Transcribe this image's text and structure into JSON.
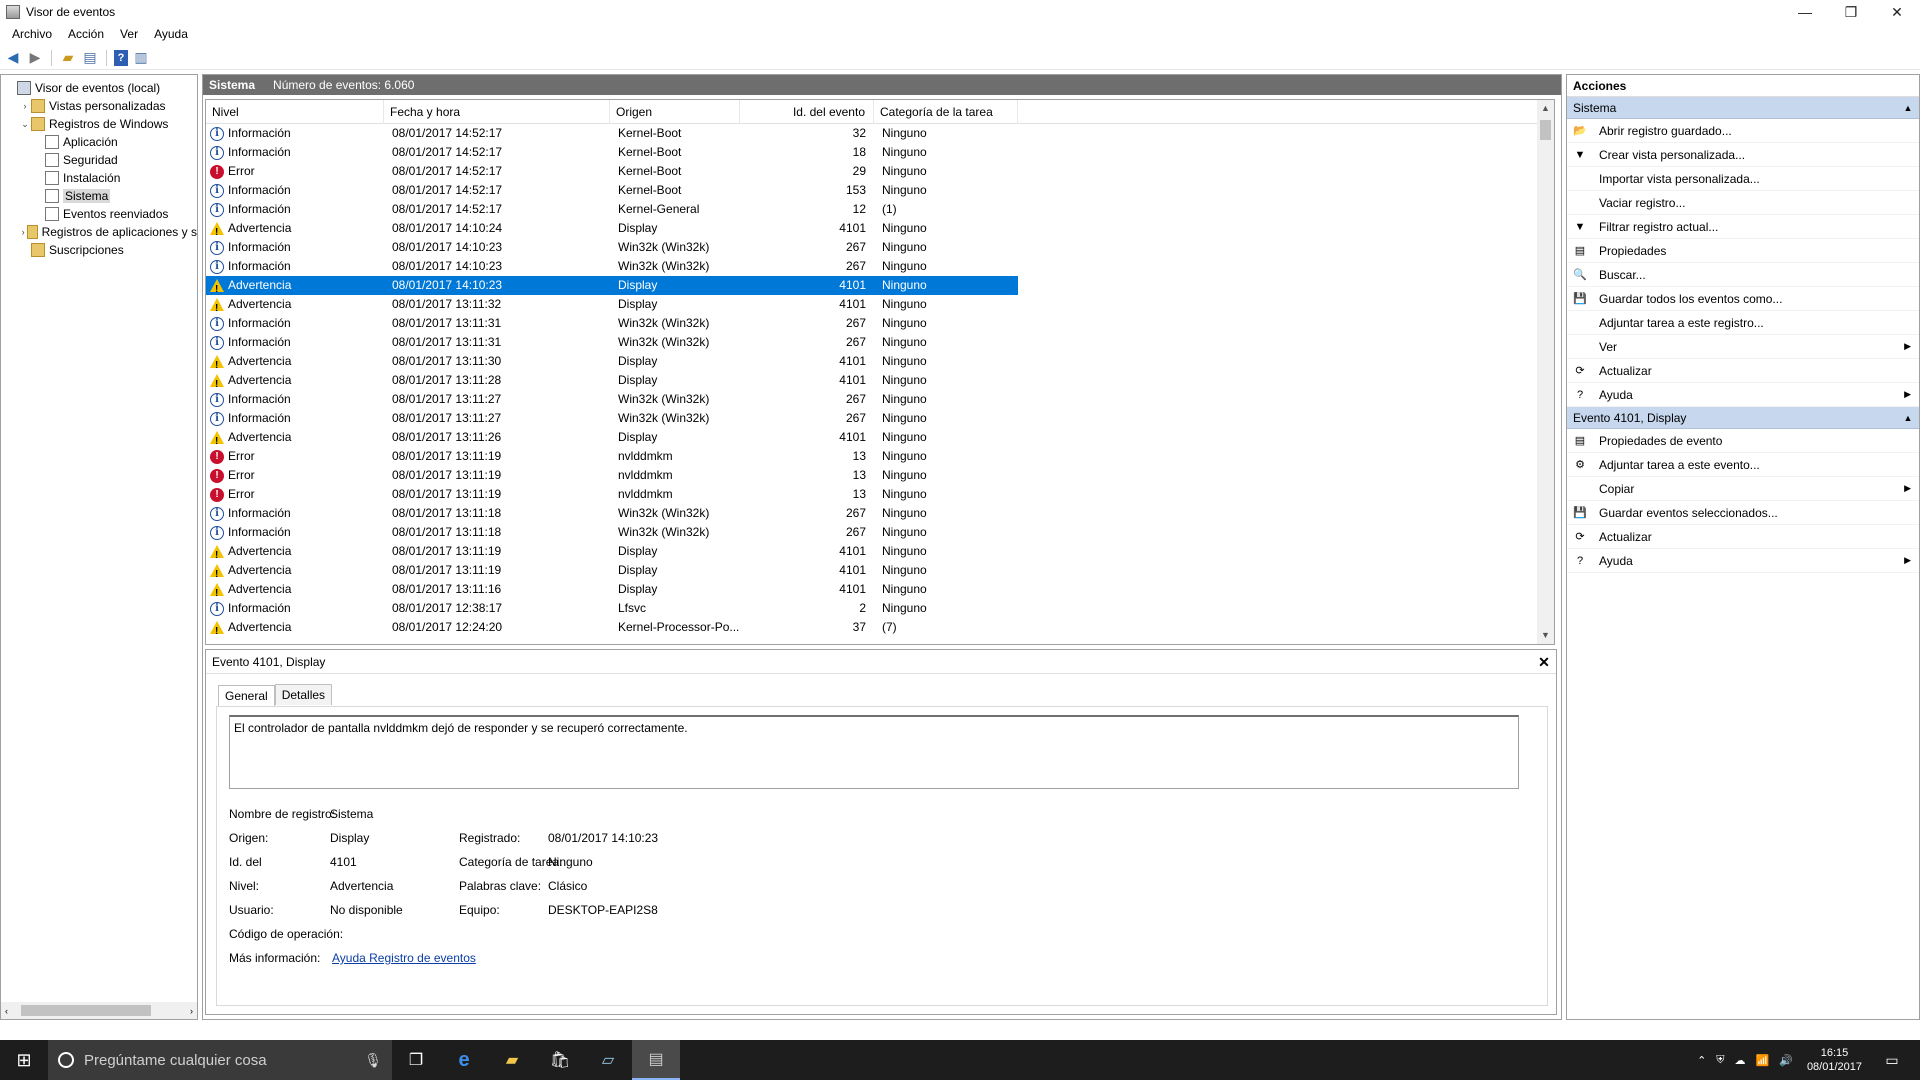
{
  "window": {
    "title": "Visor de eventos",
    "controls": {
      "minimize": "—",
      "restore": "❐",
      "close": "✕"
    }
  },
  "menu": [
    "Archivo",
    "Acción",
    "Ver",
    "Ayuda"
  ],
  "tree": [
    {
      "label": "Visor de eventos (local)",
      "indent": 0,
      "icon": "root",
      "exp": ""
    },
    {
      "label": "Vistas personalizadas",
      "indent": 1,
      "icon": "folder",
      "exp": "›"
    },
    {
      "label": "Registros de Windows",
      "indent": 1,
      "icon": "folder",
      "exp": "⌄"
    },
    {
      "label": "Aplicación",
      "indent": 2,
      "icon": "log",
      "exp": ""
    },
    {
      "label": "Seguridad",
      "indent": 2,
      "icon": "log",
      "exp": ""
    },
    {
      "label": "Instalación",
      "indent": 2,
      "icon": "log",
      "exp": ""
    },
    {
      "label": "Sistema",
      "indent": 2,
      "icon": "log",
      "exp": "",
      "selected": true
    },
    {
      "label": "Eventos reenviados",
      "indent": 2,
      "icon": "log",
      "exp": ""
    },
    {
      "label": "Registros de aplicaciones y s",
      "indent": 1,
      "icon": "folder",
      "exp": "›"
    },
    {
      "label": "Suscripciones",
      "indent": 1,
      "icon": "folder",
      "exp": ""
    }
  ],
  "log_header": {
    "name": "Sistema",
    "count_label": "Número de eventos: 6.060"
  },
  "columns": [
    "Nivel",
    "Fecha y hora",
    "Origen",
    "Id. del evento",
    "Categoría de la tarea"
  ],
  "events": [
    {
      "level": "info",
      "level_label": "Información",
      "date": "08/01/2017 14:52:17",
      "source": "Kernel-Boot",
      "id": "32",
      "category": "Ninguno"
    },
    {
      "level": "info",
      "level_label": "Información",
      "date": "08/01/2017 14:52:17",
      "source": "Kernel-Boot",
      "id": "18",
      "category": "Ninguno"
    },
    {
      "level": "error",
      "level_label": "Error",
      "date": "08/01/2017 14:52:17",
      "source": "Kernel-Boot",
      "id": "29",
      "category": "Ninguno"
    },
    {
      "level": "info",
      "level_label": "Información",
      "date": "08/01/2017 14:52:17",
      "source": "Kernel-Boot",
      "id": "153",
      "category": "Ninguno"
    },
    {
      "level": "info",
      "level_label": "Información",
      "date": "08/01/2017 14:52:17",
      "source": "Kernel-General",
      "id": "12",
      "category": "(1)"
    },
    {
      "level": "warn",
      "level_label": "Advertencia",
      "date": "08/01/2017 14:10:24",
      "source": "Display",
      "id": "4101",
      "category": "Ninguno"
    },
    {
      "level": "info",
      "level_label": "Información",
      "date": "08/01/2017 14:10:23",
      "source": "Win32k (Win32k)",
      "id": "267",
      "category": "Ninguno"
    },
    {
      "level": "info",
      "level_label": "Información",
      "date": "08/01/2017 14:10:23",
      "source": "Win32k (Win32k)",
      "id": "267",
      "category": "Ninguno"
    },
    {
      "level": "warn",
      "level_label": "Advertencia",
      "date": "08/01/2017 14:10:23",
      "source": "Display",
      "id": "4101",
      "category": "Ninguno",
      "selected": true
    },
    {
      "level": "warn",
      "level_label": "Advertencia",
      "date": "08/01/2017 13:11:32",
      "source": "Display",
      "id": "4101",
      "category": "Ninguno"
    },
    {
      "level": "info",
      "level_label": "Información",
      "date": "08/01/2017 13:11:31",
      "source": "Win32k (Win32k)",
      "id": "267",
      "category": "Ninguno"
    },
    {
      "level": "info",
      "level_label": "Información",
      "date": "08/01/2017 13:11:31",
      "source": "Win32k (Win32k)",
      "id": "267",
      "category": "Ninguno"
    },
    {
      "level": "warn",
      "level_label": "Advertencia",
      "date": "08/01/2017 13:11:30",
      "source": "Display",
      "id": "4101",
      "category": "Ninguno"
    },
    {
      "level": "warn",
      "level_label": "Advertencia",
      "date": "08/01/2017 13:11:28",
      "source": "Display",
      "id": "4101",
      "category": "Ninguno"
    },
    {
      "level": "info",
      "level_label": "Información",
      "date": "08/01/2017 13:11:27",
      "source": "Win32k (Win32k)",
      "id": "267",
      "category": "Ninguno"
    },
    {
      "level": "info",
      "level_label": "Información",
      "date": "08/01/2017 13:11:27",
      "source": "Win32k (Win32k)",
      "id": "267",
      "category": "Ninguno"
    },
    {
      "level": "warn",
      "level_label": "Advertencia",
      "date": "08/01/2017 13:11:26",
      "source": "Display",
      "id": "4101",
      "category": "Ninguno"
    },
    {
      "level": "error",
      "level_label": "Error",
      "date": "08/01/2017 13:11:19",
      "source": "nvlddmkm",
      "id": "13",
      "category": "Ninguno"
    },
    {
      "level": "error",
      "level_label": "Error",
      "date": "08/01/2017 13:11:19",
      "source": "nvlddmkm",
      "id": "13",
      "category": "Ninguno"
    },
    {
      "level": "error",
      "level_label": "Error",
      "date": "08/01/2017 13:11:19",
      "source": "nvlddmkm",
      "id": "13",
      "category": "Ninguno"
    },
    {
      "level": "info",
      "level_label": "Información",
      "date": "08/01/2017 13:11:18",
      "source": "Win32k (Win32k)",
      "id": "267",
      "category": "Ninguno"
    },
    {
      "level": "info",
      "level_label": "Información",
      "date": "08/01/2017 13:11:18",
      "source": "Win32k (Win32k)",
      "id": "267",
      "category": "Ninguno"
    },
    {
      "level": "warn",
      "level_label": "Advertencia",
      "date": "08/01/2017 13:11:19",
      "source": "Display",
      "id": "4101",
      "category": "Ninguno"
    },
    {
      "level": "warn",
      "level_label": "Advertencia",
      "date": "08/01/2017 13:11:19",
      "source": "Display",
      "id": "4101",
      "category": "Ninguno"
    },
    {
      "level": "warn",
      "level_label": "Advertencia",
      "date": "08/01/2017 13:11:16",
      "source": "Display",
      "id": "4101",
      "category": "Ninguno"
    },
    {
      "level": "info",
      "level_label": "Información",
      "date": "08/01/2017 12:38:17",
      "source": "Lfsvc",
      "id": "2",
      "category": "Ninguno"
    },
    {
      "level": "warn",
      "level_label": "Advertencia",
      "date": "08/01/2017 12:24:20",
      "source": "Kernel-Processor-Po...",
      "id": "37",
      "category": "(7)"
    }
  ],
  "detail": {
    "title": "Evento 4101, Display",
    "tabs": [
      "General",
      "Detalles"
    ],
    "description": "El controlador de pantalla nvlddmkm dejó de responder y se recuperó correctamente.",
    "props": {
      "log_name_label": "Nombre de registro:",
      "log_name": "Sistema",
      "source_label": "Origen:",
      "source": "Display",
      "logged_label": "Registrado:",
      "logged": "08/01/2017 14:10:23",
      "event_id_label": "Id. del",
      "event_id": "4101",
      "task_cat_label": "Categoría de tarea:",
      "task_cat": "Ninguno",
      "level_label": "Nivel:",
      "level": "Advertencia",
      "keywords_label": "Palabras clave:",
      "keywords": "Clásico",
      "user_label": "Usuario:",
      "user": "No disponible",
      "computer_label": "Equipo:",
      "computer": "DESKTOP-EAPI2S8",
      "opcode_label": "Código de operación:",
      "more_info_label": "Más información:",
      "more_info_link": "Ayuda Registro de eventos"
    }
  },
  "actions": {
    "header": "Acciones",
    "section1": "Sistema",
    "items1": [
      {
        "label": "Abrir registro guardado...",
        "icon": "📂"
      },
      {
        "label": "Crear vista personalizada...",
        "icon": "▼"
      },
      {
        "label": "Importar vista personalizada...",
        "icon": ""
      },
      {
        "label": "Vaciar registro...",
        "icon": ""
      },
      {
        "label": "Filtrar registro actual...",
        "icon": "▼"
      },
      {
        "label": "Propiedades",
        "icon": "▤"
      },
      {
        "label": "Buscar...",
        "icon": "🔍"
      },
      {
        "label": "Guardar todos los eventos como...",
        "icon": "💾"
      },
      {
        "label": "Adjuntar tarea a este registro...",
        "icon": ""
      },
      {
        "label": "Ver",
        "icon": "",
        "sub": true
      },
      {
        "label": "Actualizar",
        "icon": "⟳"
      },
      {
        "label": "Ayuda",
        "icon": "?",
        "sub": true
      }
    ],
    "section2": "Evento 4101, Display",
    "items2": [
      {
        "label": "Propiedades de evento",
        "icon": "▤"
      },
      {
        "label": "Adjuntar tarea a este evento...",
        "icon": "⚙"
      },
      {
        "label": "Copiar",
        "icon": "",
        "sub": true
      },
      {
        "label": "Guardar eventos seleccionados...",
        "icon": "💾"
      },
      {
        "label": "Actualizar",
        "icon": "⟳"
      },
      {
        "label": "Ayuda",
        "icon": "?",
        "sub": true
      }
    ]
  },
  "taskbar": {
    "search_placeholder": "Pregúntame cualquier cosa",
    "time": "16:15",
    "date": "08/01/2017"
  }
}
